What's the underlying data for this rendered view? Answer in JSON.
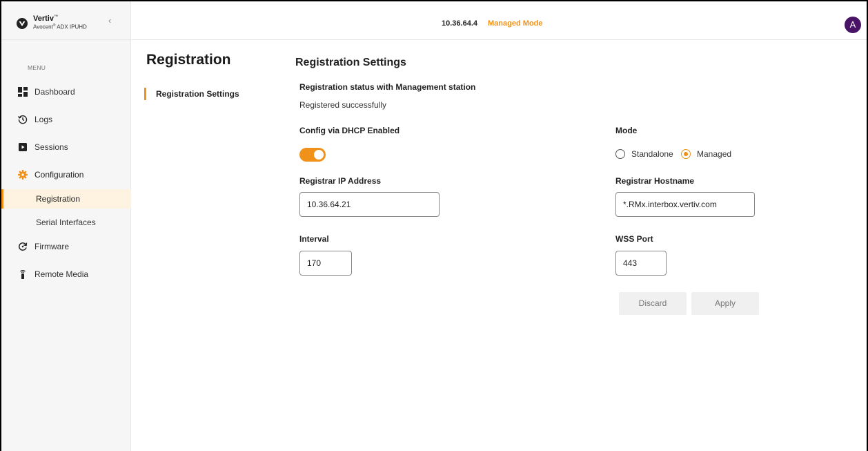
{
  "brand": {
    "name": "Vertiv",
    "name_tm": "™",
    "product": "Avocent",
    "product_reg": "®",
    "product_model": "ADX IPUHD",
    "collapse_glyph": "‹"
  },
  "topbar": {
    "ip": "10.36.64.4",
    "mode": "Managed Mode",
    "avatar_initial": "A"
  },
  "sidebar": {
    "menu_label": "MENU",
    "items": [
      {
        "label": "Dashboard",
        "icon": "dashboard-icon"
      },
      {
        "label": "Logs",
        "icon": "history-icon"
      },
      {
        "label": "Sessions",
        "icon": "sessions-icon"
      },
      {
        "label": "Configuration",
        "icon": "gear-icon",
        "accent": true
      },
      {
        "label": "Registration",
        "sub": true,
        "active": true
      },
      {
        "label": "Serial Interfaces",
        "sub": true
      },
      {
        "label": "Firmware",
        "icon": "refresh-icon"
      },
      {
        "label": "Remote Media",
        "icon": "usb-icon"
      }
    ]
  },
  "page": {
    "title": "Registration",
    "subnav": [
      "Registration Settings"
    ]
  },
  "settings": {
    "section_title": "Registration Settings",
    "status_label": "Registration status with Management station",
    "status_value": "Registered successfully",
    "dhcp_label": "Config via DHCP Enabled",
    "dhcp_enabled": true,
    "mode_label": "Mode",
    "mode_options": [
      "Standalone",
      "Managed"
    ],
    "mode_selected": "Managed",
    "registrar_ip_label": "Registrar IP Address",
    "registrar_ip_value": "10.36.64.21",
    "registrar_host_label": "Registrar Hostname",
    "registrar_host_value": "*.RMx.interbox.vertiv.com",
    "interval_label": "Interval",
    "interval_value": "170",
    "wss_port_label": "WSS Port",
    "wss_port_value": "443",
    "discard_label": "Discard",
    "apply_label": "Apply"
  },
  "colors": {
    "accent": "#f0911a",
    "avatar": "#4a1466",
    "sidebar_bg": "#f6f6f6",
    "active_bg": "#fdf3e0"
  }
}
